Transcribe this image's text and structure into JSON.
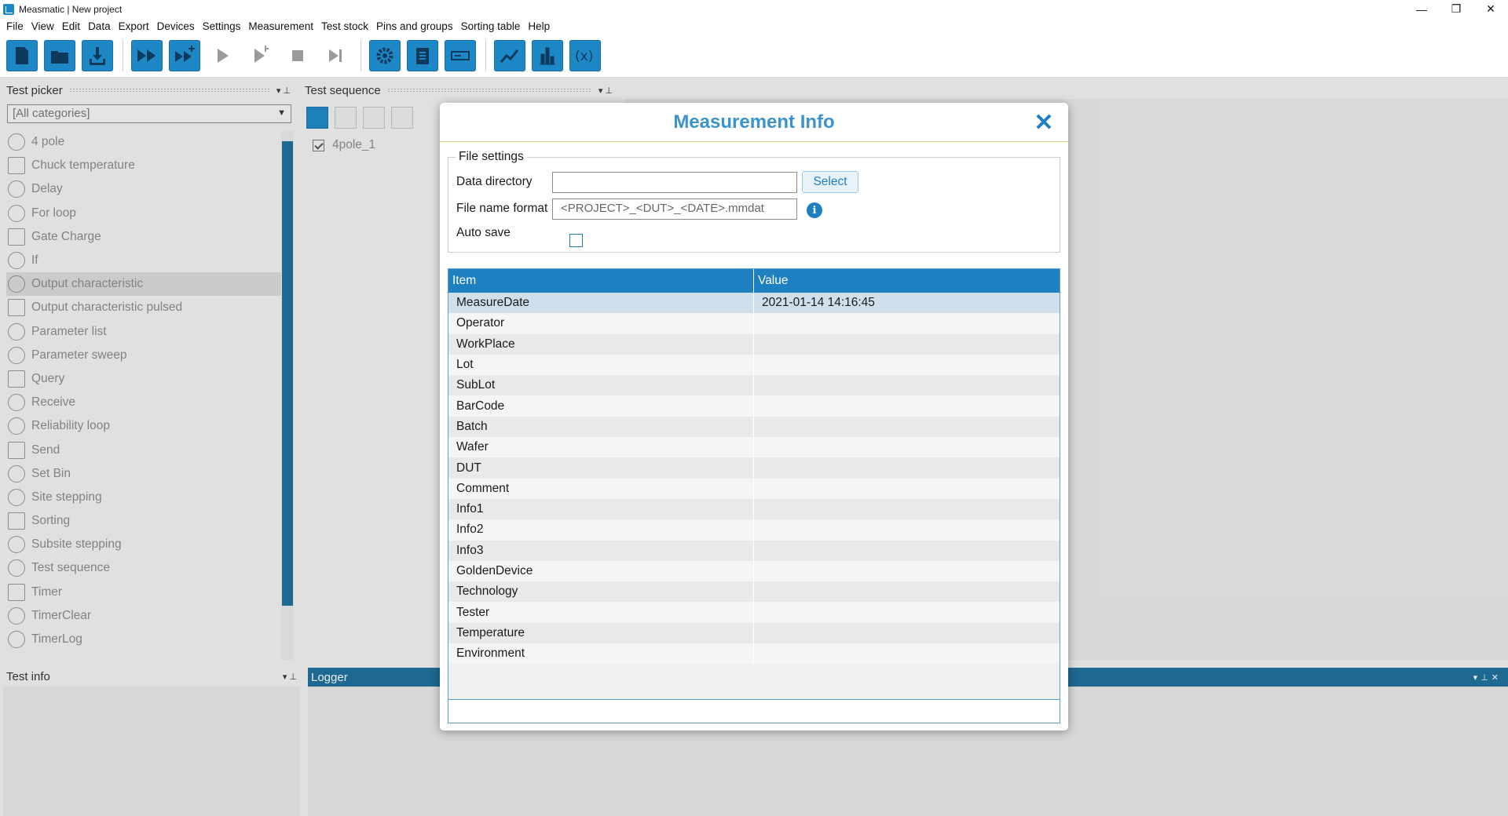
{
  "window": {
    "title": "Measmatic | New project",
    "controls": [
      "—",
      "❐",
      "✕"
    ]
  },
  "menu": [
    "File",
    "View",
    "Edit",
    "Data",
    "Export",
    "Devices",
    "Settings",
    "Measurement",
    "Test stock",
    "Pins and groups",
    "Sorting table",
    "Help"
  ],
  "toolbar": {
    "buttons": [
      {
        "icon": "new-file-icon",
        "enabled": true
      },
      {
        "icon": "open-folder-icon",
        "enabled": true
      },
      {
        "icon": "save-download-icon",
        "enabled": true
      },
      {
        "icon": "run-all-icon",
        "enabled": true
      },
      {
        "icon": "run-all-plus-icon",
        "enabled": true
      },
      {
        "icon": "play-icon",
        "enabled": false
      },
      {
        "icon": "step-play-icon",
        "enabled": false
      },
      {
        "icon": "stop-icon",
        "enabled": false
      },
      {
        "icon": "skip-end-icon",
        "enabled": false
      },
      {
        "icon": "gear-icon",
        "enabled": true
      },
      {
        "icon": "clipboard-icon",
        "enabled": true
      },
      {
        "icon": "panel-icon",
        "enabled": true
      },
      {
        "icon": "line-chart-icon",
        "enabled": true
      },
      {
        "icon": "bar-chart-icon",
        "enabled": true
      },
      {
        "icon": "variable-x-icon",
        "enabled": true
      }
    ]
  },
  "test_picker": {
    "title": "Test picker",
    "filter": "[All categories]",
    "items": [
      "4 pole",
      "Chuck temperature",
      "Delay",
      "For loop",
      "Gate Charge",
      "If",
      "Output characteristic",
      "Output characteristic pulsed",
      "Parameter list",
      "Parameter sweep",
      "Query",
      "Receive",
      "Reliability loop",
      "Send",
      "Set Bin",
      "Site stepping",
      "Sorting",
      "Subsite stepping",
      "Test sequence",
      "Timer",
      "TimerClear",
      "TimerLog"
    ],
    "selected_index": 6
  },
  "test_sequence": {
    "title": "Test sequence",
    "items": [
      {
        "label": "4pole_1",
        "checked": true
      }
    ]
  },
  "test_info": {
    "title": "Test info"
  },
  "logger": {
    "title": "Logger"
  },
  "dialog": {
    "title": "Measurement Info",
    "close": "✕",
    "file_settings": {
      "legend": "File settings",
      "data_directory_label": "Data directory",
      "data_directory_value": "",
      "select_label": "Select",
      "file_name_format_label": "File name format",
      "file_name_format_value": "<PROJECT>_<DUT>_<DATE>.mmdat",
      "info": "i",
      "auto_save_label": "Auto save",
      "auto_save_checked": false
    },
    "table": {
      "headers": [
        "Item",
        "Value"
      ],
      "rows": [
        [
          "MeasureDate",
          "2021-01-14 14:16:45"
        ],
        [
          "Operator",
          ""
        ],
        [
          "WorkPlace",
          ""
        ],
        [
          "Lot",
          ""
        ],
        [
          "SubLot",
          ""
        ],
        [
          "BarCode",
          ""
        ],
        [
          "Batch",
          ""
        ],
        [
          "Wafer",
          ""
        ],
        [
          "DUT",
          ""
        ],
        [
          "Comment",
          ""
        ],
        [
          "Info1",
          ""
        ],
        [
          "Info2",
          ""
        ],
        [
          "Info3",
          ""
        ],
        [
          "GoldenDevice",
          ""
        ],
        [
          "Technology",
          ""
        ],
        [
          "Tester",
          ""
        ],
        [
          "Temperature",
          ""
        ],
        [
          "Environment",
          ""
        ]
      ]
    }
  },
  "colors": {
    "accent": "#1e88c7",
    "title": "#3a93cc",
    "panel_dark": "#1e6f9c"
  }
}
